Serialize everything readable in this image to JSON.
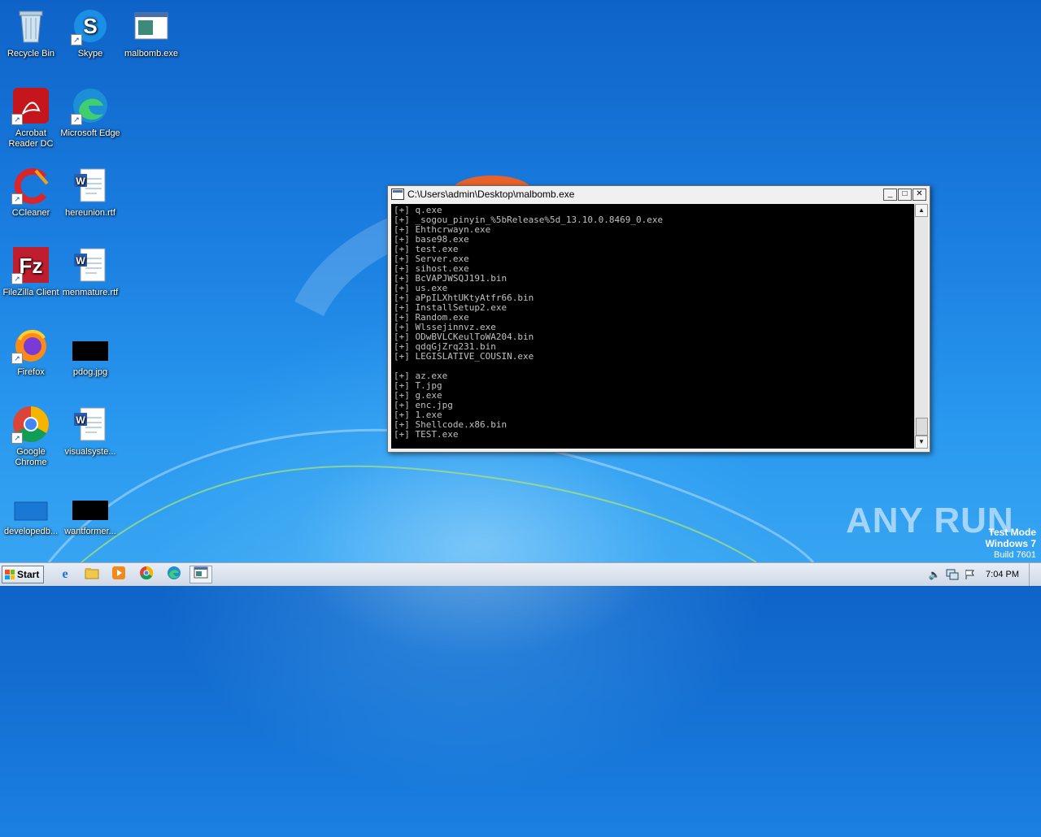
{
  "desktop": {
    "icons": [
      {
        "label": "Recycle Bin",
        "icon": "recycle-bin-icon"
      },
      {
        "label": "Skype",
        "icon": "skype-icon"
      },
      {
        "label": "malbomb.exe",
        "icon": "exe-window-icon"
      },
      {
        "label": "Acrobat Reader DC",
        "icon": "acrobat-icon"
      },
      {
        "label": "Microsoft Edge",
        "icon": "edge-icon"
      },
      {
        "label": "CCleaner",
        "icon": "ccleaner-icon"
      },
      {
        "label": "hereunion.rtf",
        "icon": "word-doc-icon"
      },
      {
        "label": "FileZilla Client",
        "icon": "filezilla-icon"
      },
      {
        "label": "menmature.rtf",
        "icon": "word-doc-icon"
      },
      {
        "label": "Firefox",
        "icon": "firefox-icon"
      },
      {
        "label": "pdog.jpg",
        "icon": "image-thumb-icon"
      },
      {
        "label": "Google Chrome",
        "icon": "chrome-icon"
      },
      {
        "label": "visualsyste...",
        "icon": "word-doc-icon"
      },
      {
        "label": "developedb...",
        "icon": "blank-file-icon"
      },
      {
        "label": "wantformer...",
        "icon": "image-thumb-icon"
      }
    ]
  },
  "console": {
    "title": "C:\\Users\\admin\\Desktop\\malbomb.exe",
    "lines": [
      "[+] q.exe",
      "[+] _sogou_pinyin_%5bRelease%5d_13.10.0.8469_0.exe",
      "[+] Ehthcrwayn.exe",
      "[+] base98.exe",
      "[+] test.exe",
      "[+] Server.exe",
      "[+] sihost.exe",
      "[+] BcVAPJWSQJ191.bin",
      "[+] us.exe",
      "[+] aPpILXhtUKtyAtfr66.bin",
      "[+] InstallSetup2.exe",
      "[+] Random.exe",
      "[+] Wlssejinnvz.exe",
      "[+] ODwBVLCKeulToWA204.bin",
      "[+] qdqGjZrq231.bin",
      "[+] LEGISLATIVE_COUSIN.exe",
      "",
      "[+] az.exe",
      "[+] T.jpg",
      "[+] g.exe",
      "[+] enc.jpg",
      "[+] 1.exe",
      "[+] Shellcode.x86.bin",
      "[+] TEST.exe"
    ]
  },
  "watermark": {
    "brand": "ANY RUN",
    "mode": "Test Mode",
    "os": "Windows 7",
    "build": "Build 7601"
  },
  "taskbar": {
    "start_label": "Start",
    "clock": "7:04 PM",
    "pinned": [
      "ie-icon",
      "explorer-icon",
      "media-player-icon",
      "chrome-icon",
      "edge-icon",
      "console-window-icon"
    ]
  }
}
